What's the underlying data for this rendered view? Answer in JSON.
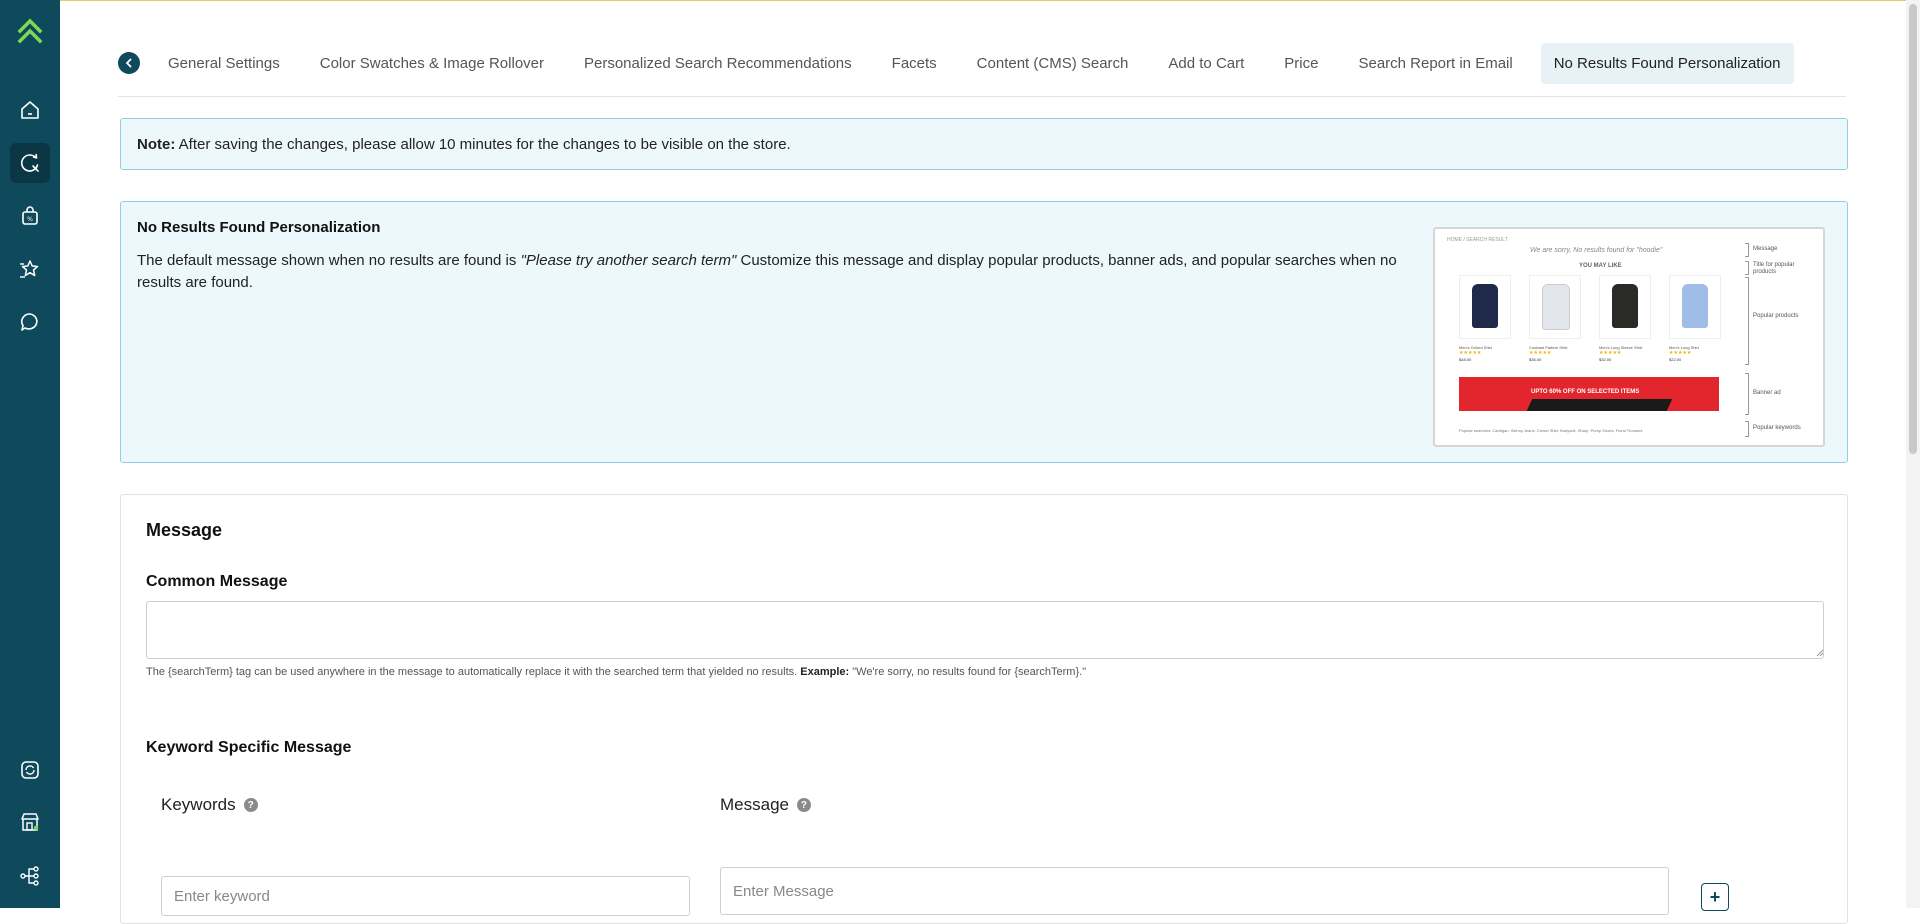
{
  "sidebar": {
    "logo_icon": "double-chevron-up-logo",
    "items": [
      {
        "name": "home",
        "icon": "home-icon",
        "active": false
      },
      {
        "name": "search",
        "icon": "search-refresh-icon",
        "active": true
      },
      {
        "name": "bag",
        "icon": "shopping-bag-icon",
        "active": false
      },
      {
        "name": "star",
        "icon": "star-list-icon",
        "active": false
      },
      {
        "name": "chat",
        "icon": "chat-bubble-icon",
        "active": false
      },
      {
        "name": "sync",
        "icon": "sync-icon",
        "active": false
      },
      {
        "name": "store",
        "icon": "store-icon",
        "active": false
      },
      {
        "name": "hierarchy",
        "icon": "hierarchy-icon",
        "active": false
      }
    ],
    "colors": {
      "background": "#0f4a5c",
      "active_background": "#0b3644",
      "logo": "#7ed957"
    }
  },
  "tabs": {
    "items": [
      {
        "label": "General Settings",
        "active": false
      },
      {
        "label": "Color Swatches & Image Rollover",
        "active": false
      },
      {
        "label": "Personalized Search Recommendations",
        "active": false
      },
      {
        "label": "Facets",
        "active": false
      },
      {
        "label": "Content (CMS) Search",
        "active": false
      },
      {
        "label": "Add to Cart",
        "active": false
      },
      {
        "label": "Price",
        "active": false
      },
      {
        "label": "Search Report in Email",
        "active": false
      },
      {
        "label": "No Results Found Personalization",
        "active": true
      }
    ]
  },
  "note": {
    "label": "Note:",
    "text": " After saving the changes, please allow 10 minutes for the changes to be visible on the store."
  },
  "info": {
    "title": "No Results Found Personalization",
    "desc_prefix": "The default message shown when no results are found is ",
    "desc_italic": "\"Please try another search term\"",
    "desc_suffix": " Customize this message and display popular products, banner ads, and popular searches when no results are found.",
    "preview": {
      "crumb": "HOME / SEARCH RESULT",
      "message": "We are sorry, No results found for \"hoodie\"",
      "title": "YOU MAY LIKE",
      "products": [
        {
          "name": "Men's Oxford Shirt",
          "stars": "★★★★★",
          "price": "$48.00",
          "color": "#1f2a4a"
        },
        {
          "name": "Contrast Pattern Shirt",
          "stars": "★★★★★",
          "price": "$36.00",
          "color": "#e4e6ee"
        },
        {
          "name": "Men's Long Sleeve Shirt",
          "stars": "★★★★★",
          "price": "$32.00",
          "color": "#2a2a26"
        },
        {
          "name": "Men's Long Shirt",
          "stars": "★★★★★",
          "price": "$22.00",
          "color": "#9fbde6"
        }
      ],
      "banner": "UPTO 60% OFF ON SELECTED ITEMS",
      "popular": "Popular searches: Cardigan, Skinny Jeans, Corset Shirt, Bodysuit, Sharp, Pump Shoes, Floral Trousers",
      "labels": {
        "message": "Message",
        "title": "Title for popular products",
        "products": "Popular products",
        "banner": "Banner ad",
        "keywords": "Popular keywords"
      }
    }
  },
  "message_section": {
    "heading": "Message",
    "common_label": "Common Message",
    "common_value": "",
    "help_prefix": "The {searchTerm} tag can be used anywhere in the message to automatically replace it with the searched term that yielded no results. ",
    "help_example_label": "Example:",
    "help_example": " \"We're sorry, no results found for {searchTerm}.\"",
    "keyword_heading": "Keyword Specific Message",
    "keywords_col": "Keywords",
    "message_col": "Message",
    "keyword_placeholder": "Enter keyword",
    "message_placeholder": "Enter Message",
    "keyword_value": "",
    "message_value": "",
    "add_label": "+"
  }
}
